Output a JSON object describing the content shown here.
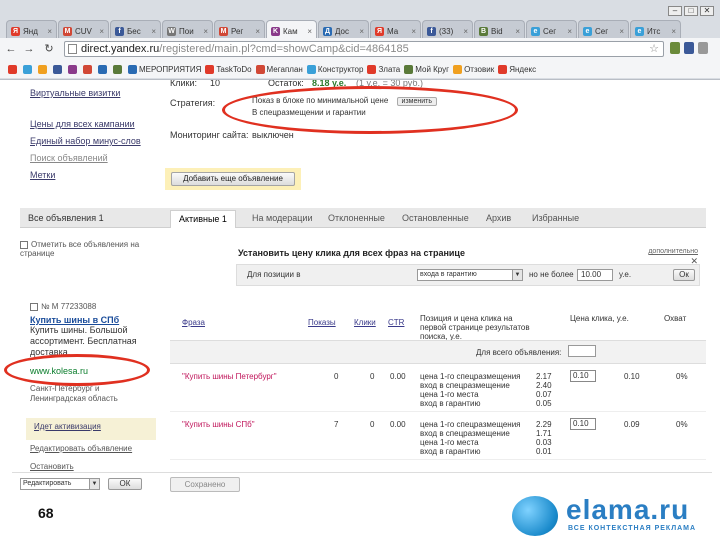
{
  "browser": {
    "tabs": [
      {
        "label": "Янд",
        "color": "#e03a2a",
        "glyph": "Я"
      },
      {
        "label": "CUV",
        "color": "#d14836",
        "glyph": "M"
      },
      {
        "label": "Бес",
        "color": "#3b5998",
        "glyph": "f"
      },
      {
        "label": "Пои",
        "color": "#777777",
        "glyph": "W"
      },
      {
        "label": "Рег",
        "color": "#d14836",
        "glyph": "M"
      },
      {
        "label": "Кам",
        "color": "#8a3a8a",
        "glyph": "K",
        "active": true
      },
      {
        "label": "Дос",
        "color": "#2a6bb3",
        "glyph": "Д"
      },
      {
        "label": "Ма",
        "color": "#e03a2a",
        "glyph": "Я"
      },
      {
        "label": "(33)",
        "color": "#3b5998",
        "glyph": "f"
      },
      {
        "label": "Bid",
        "color": "#5a7a3a",
        "glyph": "B"
      },
      {
        "label": "Сег",
        "color": "#3aa0d8",
        "glyph": "e"
      },
      {
        "label": "Сег",
        "color": "#3aa0d8",
        "glyph": "e"
      },
      {
        "label": "Итс",
        "color": "#3aa0d8",
        "glyph": "e"
      }
    ],
    "url_host": "direct.yandex.ru",
    "url_path": "/registered/main.pl?cmd=showCamp&cid=4864185",
    "bookmarks": [
      {
        "label": "",
        "color": "#e03a2a"
      },
      {
        "label": "",
        "color": "#3aa0d8"
      },
      {
        "label": "",
        "color": "#f0a020"
      },
      {
        "label": "",
        "color": "#3b5998"
      },
      {
        "label": "",
        "color": "#8a3a8a"
      },
      {
        "label": "",
        "color": "#d14836"
      },
      {
        "label": "",
        "color": "#2a6bb3"
      },
      {
        "label": "",
        "color": "#5a7a3a"
      },
      {
        "label": "МЕРОПРИЯТИЯ",
        "color": "#2a6bb3"
      },
      {
        "label": "TaskToDo",
        "color": "#e03a2a"
      },
      {
        "label": "Мегаплан",
        "color": "#d14836"
      },
      {
        "label": "Конструктор",
        "color": "#3aa0d8"
      },
      {
        "label": "Злата",
        "color": "#e03a2a"
      },
      {
        "label": "Мой Круг",
        "color": "#5a7a3a"
      },
      {
        "label": "Отзовик",
        "color": "#f0a020"
      },
      {
        "label": "Яндекс",
        "color": "#e03a2a"
      }
    ]
  },
  "left_nav": {
    "vcards": "Виртуальные визитки",
    "prices": "Цены для всех кампании",
    "minus_words": "Единый набор минус-слов",
    "ads_search": "Поиск объявлений",
    "tags": "Метки"
  },
  "stats": {
    "clicks_label": "Клики:",
    "clicks_value": "10",
    "spent_label": "Остаток:",
    "spent_value": "8.18 у.е.",
    "rate": "(1 у.е. = 30 руб.)",
    "strategy_label": "Стратегия:",
    "strategy_value": "Показ в блоке по минимальной цене",
    "strategy_change": "изменить",
    "strategy_sub": "В спецразмещении и гарантии",
    "monitor_label": "Мониторинг сайта:",
    "monitor_value": "выключен"
  },
  "add_ad_button": "Добавить еще объявление",
  "tabs": {
    "all_ads": "Все объявления 1",
    "items": [
      "Активные 1",
      "На модерации",
      "Отклоненные",
      "Остановленные",
      "Архив",
      "Избранные"
    ]
  },
  "bulk": {
    "label": "Отметить все объявления на странице"
  },
  "bid_panel": {
    "title": "Установить цену клика для всех фраз на странице",
    "help": "дополнительно",
    "close": "✕",
    "label1": "Для позиции в",
    "select_value": "входа в гарантию",
    "label2": "но не более",
    "max_value": "10.00",
    "currency": "у.е.",
    "ok": "Ок"
  },
  "ad": {
    "number": "№ М 77233088",
    "title": "Купить шины в СПб",
    "text": "Купить шины. Большой ассортимент. Бесплатная доставка.",
    "url": "www.kolesa.ru",
    "geo": "Санкт-Петербург и Ленинградская область",
    "action1": "Идет активизация",
    "action2": "Редактировать объявление",
    "action3": "Остановить"
  },
  "table": {
    "headers": {
      "phrase": "Фраза",
      "shows": "Показы",
      "clicks": "Клики",
      "ctr": "CTR",
      "positions": "Позиция и цена клика на первой странице результатов поиска, у.е.",
      "price": "Цена клика, у.е.",
      "reach": "Охват"
    },
    "all_label": "Для всего объявления:",
    "all_value": "",
    "rows": [
      {
        "phrase": "\"Купить шины Петербург\"",
        "shows": "0",
        "clicks": "0",
        "ctr": "0.00",
        "positions": [
          "цена 1-го спецразмещения",
          "вход в спецразмещение",
          "цена 1-го места",
          "вход в гарантию"
        ],
        "prices": [
          "2.17",
          "2.40",
          "0.07",
          "0.05"
        ],
        "bid": "0.10",
        "price": "0.10",
        "reach": "0%"
      },
      {
        "phrase": "\"Купить шины СПб\"",
        "shows": "7",
        "clicks": "0",
        "ctr": "0.00",
        "positions": [
          "цена 1-го спецразмещения",
          "вход в спецразмещение",
          "цена 1-го места",
          "вход в гарантию"
        ],
        "prices": [
          "2.29",
          "1.71",
          "0.03",
          "0.01"
        ],
        "bid": "0.10",
        "price": "0.09",
        "reach": "0%"
      }
    ]
  },
  "footer": {
    "action_select": "Редактировать",
    "ok": "ОК",
    "save": "Сохранено"
  },
  "slide_number": "68",
  "brand": {
    "name": "elama.ru",
    "tagline": "ВСЕ КОНТЕКСТНАЯ РЕКЛАМА"
  }
}
